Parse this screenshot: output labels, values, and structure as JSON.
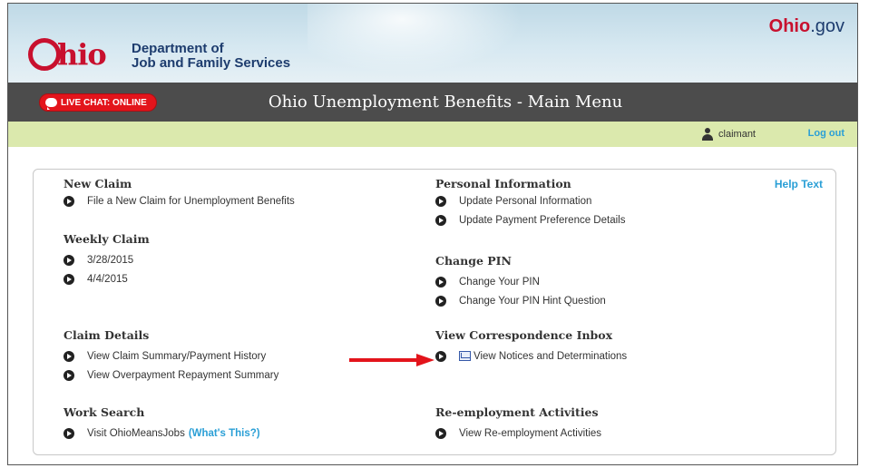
{
  "header": {
    "logo_text": "Ohio",
    "agency_line1": "Department of",
    "agency_line2": "Job and Family Services",
    "portal_ohio": "Ohio",
    "portal_gov": ".gov"
  },
  "titlebar": {
    "live_chat": "LIVE CHAT: ONLINE",
    "title": "Ohio Unemployment Benefits - Main Menu"
  },
  "userbar": {
    "username": "claimant",
    "logout": "Log out"
  },
  "panel": {
    "help_text": "Help Text",
    "left": {
      "new_claim": {
        "heading": "New Claim",
        "items": [
          "File a New Claim for Unemployment Benefits"
        ]
      },
      "weekly_claim": {
        "heading": "Weekly Claim",
        "items": [
          "3/28/2015",
          "4/4/2015"
        ]
      },
      "claim_details": {
        "heading": "Claim Details",
        "items": [
          "View Claim Summary/Payment History",
          "View Overpayment Repayment Summary"
        ]
      },
      "work_search": {
        "heading": "Work Search",
        "items": [
          "Visit OhioMeansJobs"
        ],
        "whats_this": "(What's This?)"
      }
    },
    "right": {
      "personal_info": {
        "heading": "Personal Information",
        "items": [
          "Update Personal Information",
          "Update Payment Preference Details"
        ]
      },
      "change_pin": {
        "heading": "Change PIN",
        "items": [
          "Change Your PIN",
          "Change Your PIN Hint Question"
        ]
      },
      "correspondence": {
        "heading": "View Correspondence Inbox",
        "items": [
          "View Notices and Determinations"
        ]
      },
      "reemployment": {
        "heading": "Re-employment Activities",
        "items": [
          "View Re-employment Activities"
        ]
      }
    }
  },
  "colors": {
    "ohio_red": "#c8102e",
    "agency_blue": "#1d3c6e",
    "titlebar": "#4c4c4c",
    "userbar": "#dbe9ad",
    "link_blue": "#2a9fd6",
    "annotation_arrow": "#e3141b"
  },
  "icons": [
    "person-icon",
    "chat-bubble-icon",
    "bullet-arrow-icon",
    "envelope-icon",
    "annotation-arrow"
  ]
}
